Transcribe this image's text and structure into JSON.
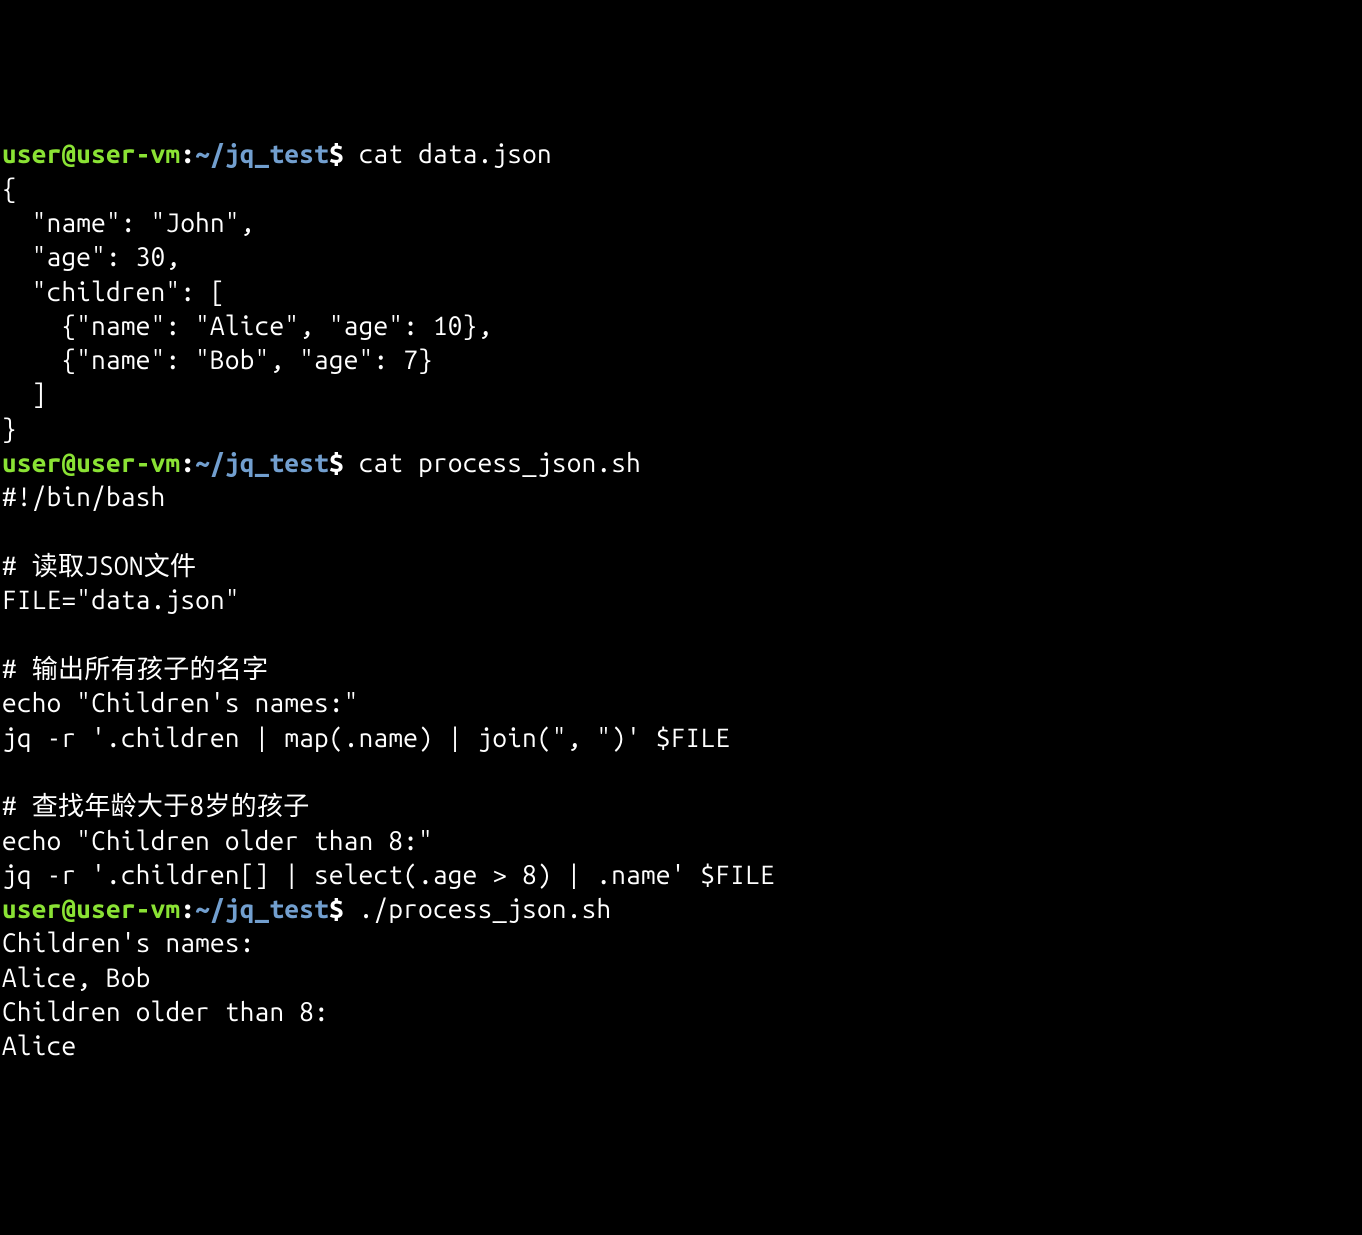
{
  "colors": {
    "background": "#000000",
    "foreground": "#ffffff",
    "prompt_user": "#8ae234",
    "prompt_path": "#729fcf"
  },
  "prompt": {
    "user_host": "user@user-vm",
    "colon": ":",
    "path": "~/jq_test",
    "dollar": "$"
  },
  "commands": {
    "cmd1": " cat data.json",
    "cmd2": " cat process_json.sh",
    "cmd3": " ./process_json.sh"
  },
  "outputs": {
    "data_json_l1": "{",
    "data_json_l2": "  \"name\": \"John\",",
    "data_json_l3": "  \"age\": 30,",
    "data_json_l4": "  \"children\": [",
    "data_json_l5": "    {\"name\": \"Alice\", \"age\": 10},",
    "data_json_l6": "    {\"name\": \"Bob\", \"age\": 7}",
    "data_json_l7": "  ]",
    "data_json_l8": "}",
    "script_l1": "#!/bin/bash",
    "script_l2": "",
    "script_l3": "# 读取JSON文件",
    "script_l4": "FILE=\"data.json\"",
    "script_l5": "",
    "script_l6": "# 输出所有孩子的名字",
    "script_l7": "echo \"Children's names:\"",
    "script_l8": "jq -r '.children | map(.name) | join(\", \")' $FILE",
    "script_l9": "",
    "script_l10": "# 查找年龄大于8岁的孩子",
    "script_l11": "echo \"Children older than 8:\"",
    "script_l12": "jq -r '.children[] | select(.age > 8) | .name' $FILE",
    "run_l1": "Children's names:",
    "run_l2": "Alice, Bob",
    "run_l3": "Children older than 8:",
    "run_l4": "Alice"
  }
}
